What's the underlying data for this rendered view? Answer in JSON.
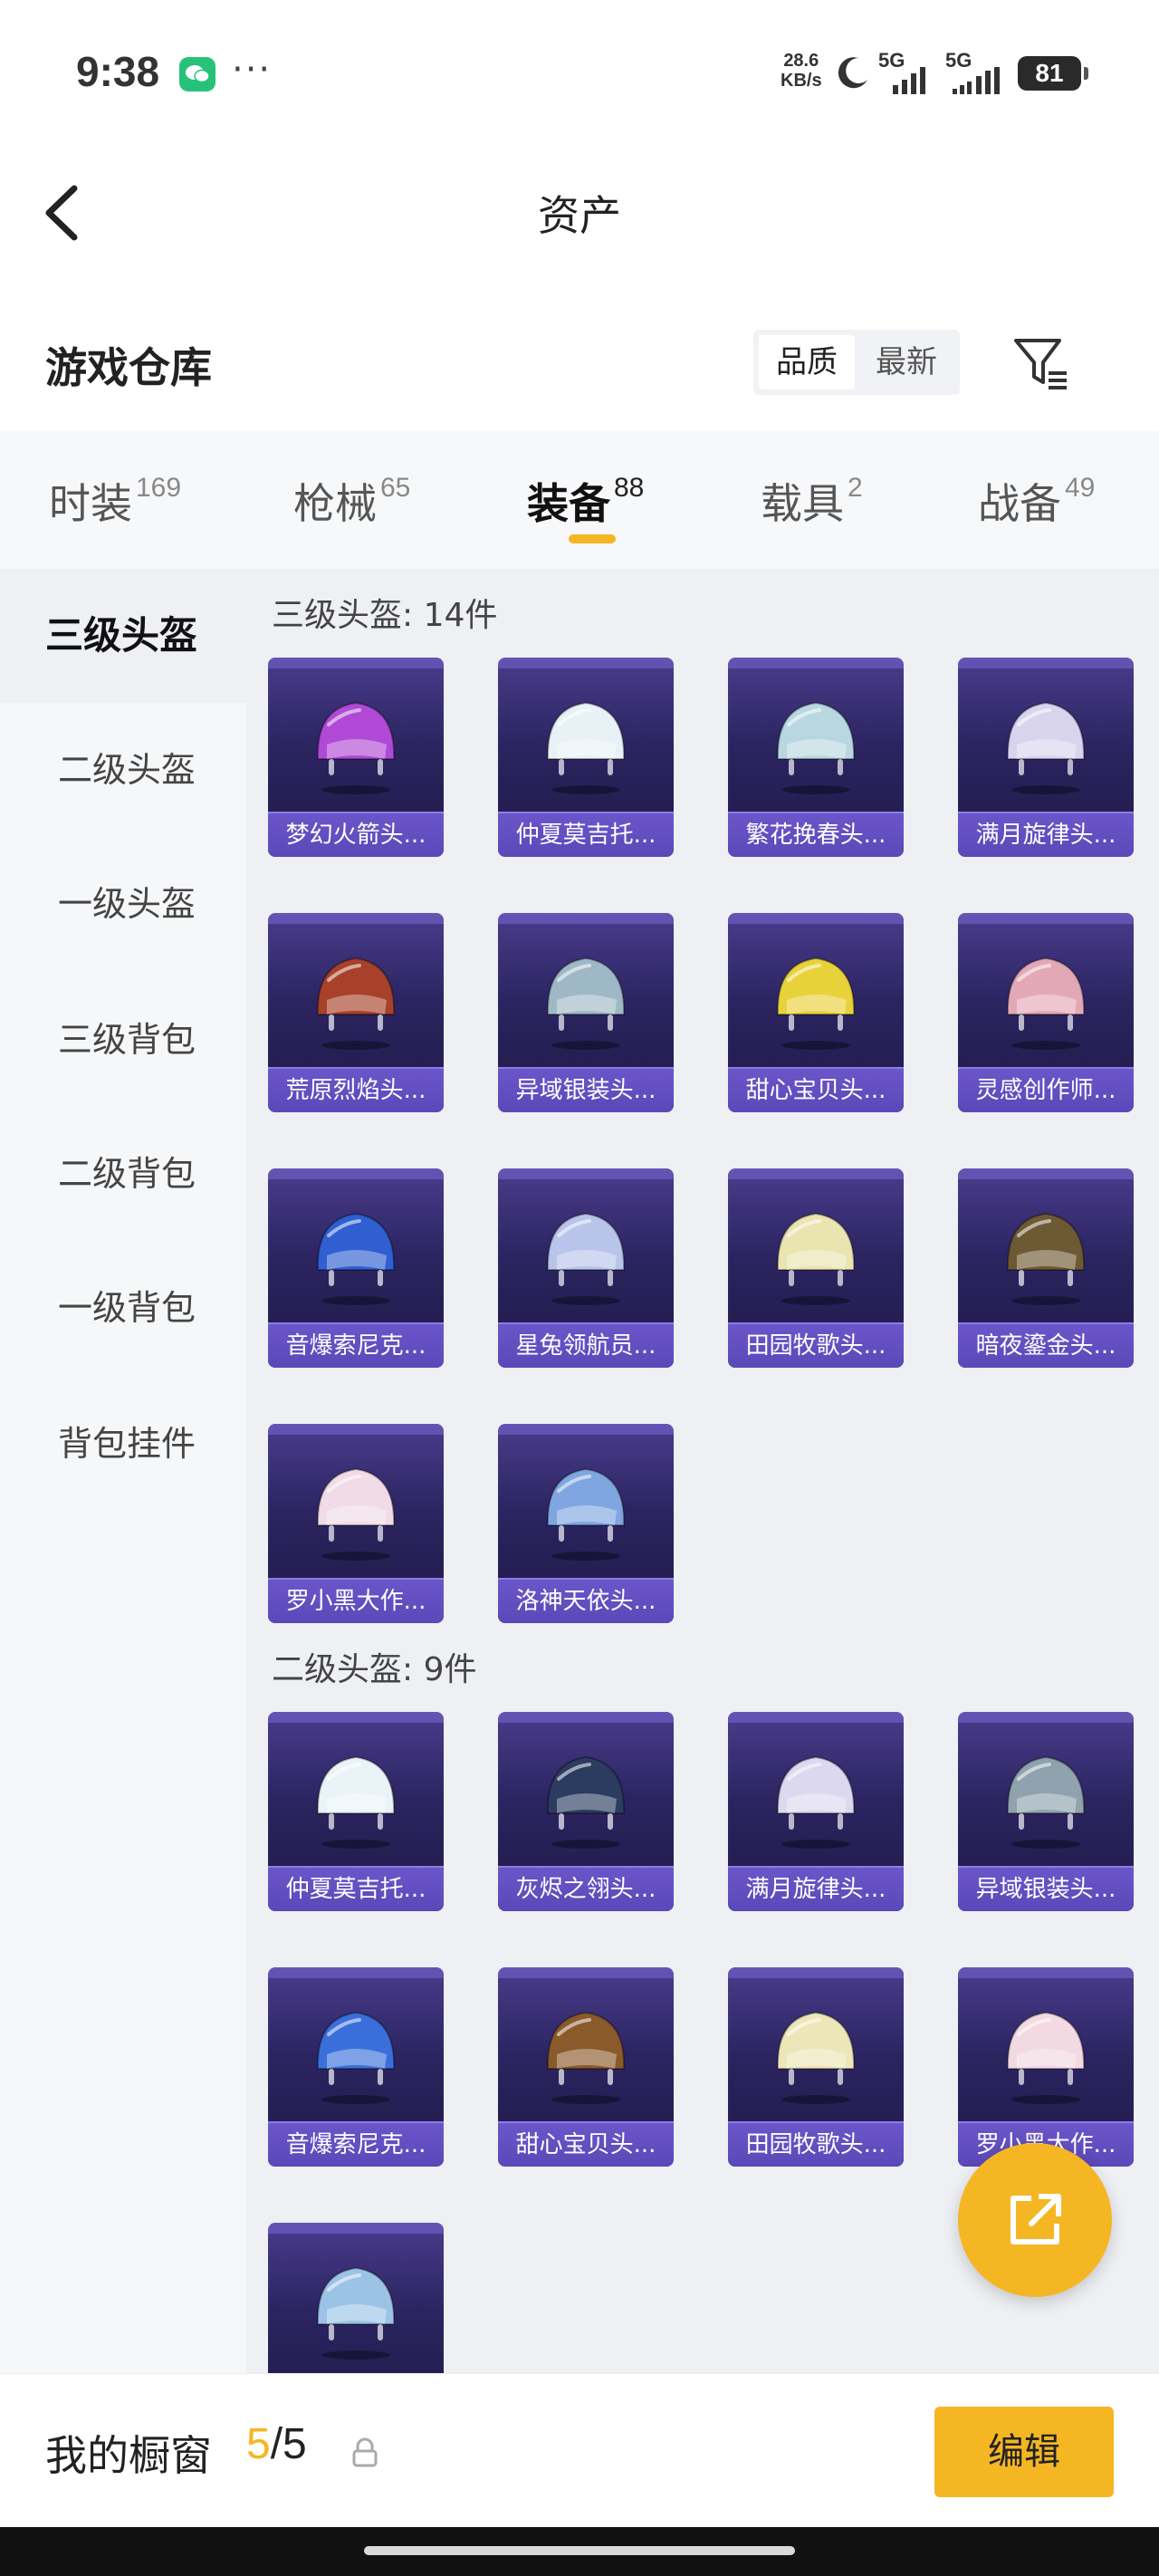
{
  "status": {
    "time": "9:38",
    "net_speed_value": "28.6",
    "net_speed_unit": "KB/s",
    "signal1": "5G",
    "signal2": "5G",
    "battery": "81"
  },
  "header": {
    "title": "资产"
  },
  "section": {
    "title": "游戏仓库",
    "sort_options": [
      "品质",
      "最新"
    ],
    "active_sort": "品质"
  },
  "categories": [
    {
      "name": "时装",
      "count": "169"
    },
    {
      "name": "枪械",
      "count": "65"
    },
    {
      "name": "装备",
      "count": "88"
    },
    {
      "name": "载具",
      "count": "2"
    },
    {
      "name": "战备",
      "count": "49"
    }
  ],
  "active_category": "装备",
  "sidebar": {
    "items": [
      "三级头盔",
      "二级头盔",
      "一级头盔",
      "三级背包",
      "二级背包",
      "一级背包",
      "背包挂件"
    ],
    "active": "三级头盔"
  },
  "groups": [
    {
      "title": "三级头盔: 14件",
      "items": [
        {
          "label": "梦幻火箭头...",
          "color": "#b04ad6"
        },
        {
          "label": "仲夏莫吉托...",
          "color": "#e8f2f6"
        },
        {
          "label": "繁花挽春头...",
          "color": "#b9d7e0"
        },
        {
          "label": "满月旋律头...",
          "color": "#d8d4ee"
        },
        {
          "label": "荒原烈焰头...",
          "color": "#a8412a"
        },
        {
          "label": "异域银装头...",
          "color": "#9fb8c6"
        },
        {
          "label": "甜心宝贝头...",
          "color": "#e8d23a"
        },
        {
          "label": "灵感创作师...",
          "color": "#e3a8b6"
        },
        {
          "label": "音爆索尼克...",
          "color": "#2f5fd0"
        },
        {
          "label": "星兔领航员...",
          "color": "#b8c4ea"
        },
        {
          "label": "田园牧歌头...",
          "color": "#e9e4b0"
        },
        {
          "label": "暗夜鎏金头...",
          "color": "#6d5a34"
        },
        {
          "label": "罗小黑大作...",
          "color": "#f0dbe6"
        },
        {
          "label": "洛神天依头...",
          "color": "#7fa6e0"
        }
      ]
    },
    {
      "title": "二级头盔: 9件",
      "items": [
        {
          "label": "仲夏莫吉托...",
          "color": "#eaf3f7"
        },
        {
          "label": "灰烬之翎头...",
          "color": "#2c3b60"
        },
        {
          "label": "满月旋律头...",
          "color": "#dcd8f0"
        },
        {
          "label": "异域银装头...",
          "color": "#8fa2ae"
        },
        {
          "label": "音爆索尼克...",
          "color": "#3a6fdb"
        },
        {
          "label": "甜心宝贝头...",
          "color": "#8a5a2a"
        },
        {
          "label": "田园牧歌头...",
          "color": "#ece6b8"
        },
        {
          "label": "罗小黑大作...",
          "color": "#f2d9e2"
        },
        {
          "label": "",
          "color": "#9cc3e6"
        }
      ]
    }
  ],
  "showcase": {
    "label": "我的橱窗",
    "current": "5",
    "total": "/5"
  },
  "edit_label": "编辑",
  "colors": {
    "accent": "#f5b623",
    "card_label": "#5a48b8"
  }
}
